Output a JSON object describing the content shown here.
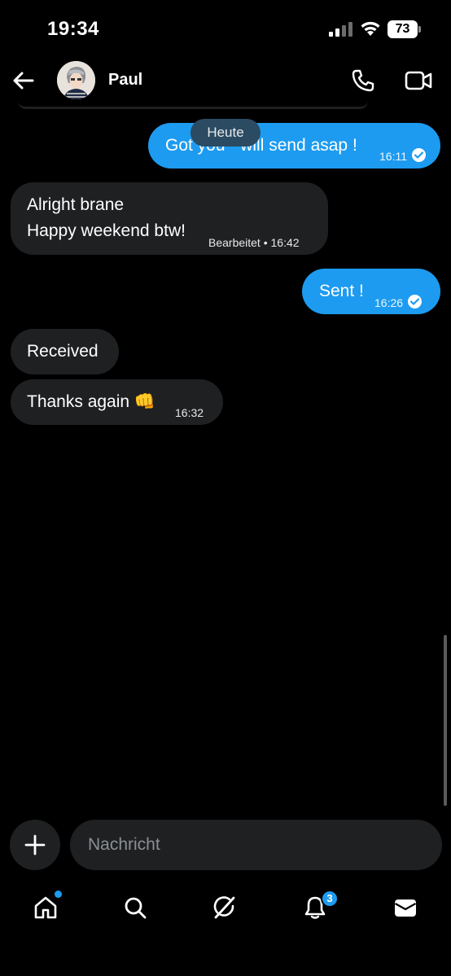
{
  "status_bar": {
    "time": "19:34",
    "battery": "73"
  },
  "header": {
    "contact_name": "Paul"
  },
  "date_separator": "Heute",
  "messages": [
    {
      "direction": "sent",
      "text": "Got you - will send asap !",
      "time": "16:11",
      "read": true
    },
    {
      "direction": "received",
      "lines": [
        "Alright brane",
        "Happy weekend btw!"
      ],
      "meta": "Bearbeitet • 16:42"
    },
    {
      "direction": "sent",
      "text": "Sent !",
      "time": "16:26",
      "read": true
    },
    {
      "direction": "received",
      "text": "Received"
    },
    {
      "direction": "received",
      "text": "Thanks again 👊",
      "time": "16:32"
    }
  ],
  "composer": {
    "placeholder": "Nachricht"
  },
  "bottom_nav": {
    "items": [
      {
        "name": "home",
        "icon": "home-icon",
        "has_dot": true
      },
      {
        "name": "search",
        "icon": "search-icon"
      },
      {
        "name": "grok",
        "icon": "grok-icon"
      },
      {
        "name": "notifications",
        "icon": "bell-icon",
        "badge": "3"
      },
      {
        "name": "messages",
        "icon": "envelope-icon"
      }
    ]
  },
  "colors": {
    "accent": "#1d9bf0",
    "received_bubble": "#1f2022",
    "background": "#000000"
  }
}
